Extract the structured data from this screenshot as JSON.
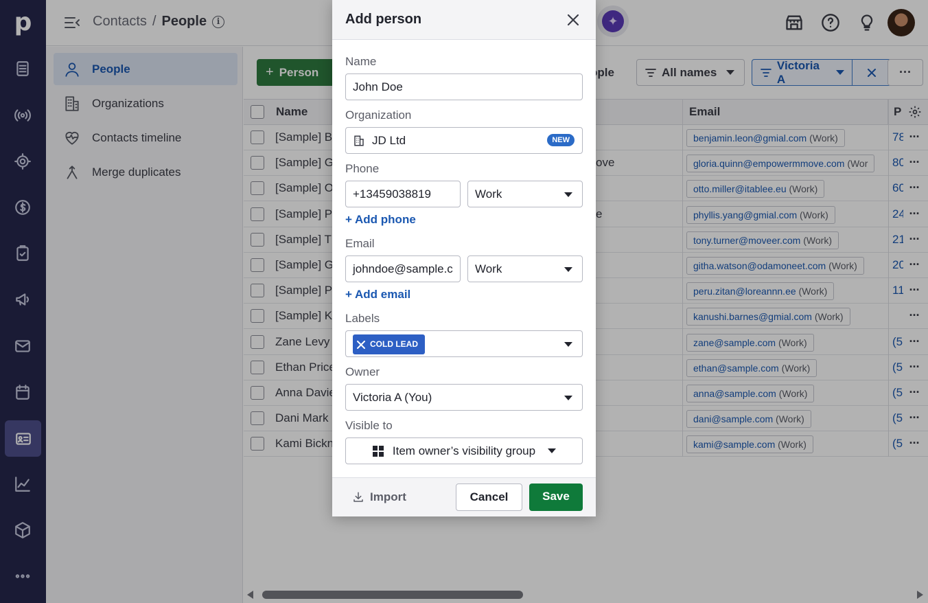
{
  "rail": {
    "logo": "p",
    "items": [
      "deals-icon",
      "leads-icon",
      "projects-icon",
      "revenue-icon",
      "activities-icon",
      "campaigns-icon",
      "mail-icon",
      "calendar-icon",
      "contacts-icon",
      "insights-icon",
      "products-icon",
      "more-icon"
    ],
    "active": "contacts-icon"
  },
  "header": {
    "breadcrumb_parent": "Contacts",
    "breadcrumb_sep": "/",
    "breadcrumb_current": "People",
    "ai_glyph": "✦"
  },
  "sidenav": {
    "items": [
      {
        "label": "People",
        "icon": "person-icon",
        "active": true
      },
      {
        "label": "Organizations",
        "icon": "building-icon",
        "active": false
      },
      {
        "label": "Contacts timeline",
        "icon": "heart-pulse-icon",
        "active": false
      },
      {
        "label": "Merge duplicates",
        "icon": "merge-icon",
        "active": false
      }
    ]
  },
  "toolbar": {
    "add_person": "Person",
    "people_partial": "ople",
    "all_names": "All names",
    "owner_filter": "Victoria A",
    "more": "···"
  },
  "table": {
    "columns": {
      "name": "Name",
      "email": "Email",
      "phone": "P"
    },
    "rows": [
      {
        "name": "[Sample] B",
        "org": "",
        "email": "benjamin.leon@gmial.com",
        "type": "(Work)",
        "phone": "78"
      },
      {
        "name": "[Sample] G",
        "org": "ove",
        "email": "gloria.quinn@empowermmove.com",
        "type": "(Wor",
        "phone": "80"
      },
      {
        "name": "[Sample] O",
        "org": "",
        "email": "otto.miller@itablee.eu",
        "type": "(Work)",
        "phone": "60"
      },
      {
        "name": "[Sample] P",
        "org": "e",
        "email": "phyllis.yang@gmial.com",
        "type": "(Work)",
        "phone": "24"
      },
      {
        "name": "[Sample] T",
        "org": "",
        "email": "tony.turner@moveer.com",
        "type": "(Work)",
        "phone": "21"
      },
      {
        "name": "[Sample] G",
        "org": "",
        "email": "githa.watson@odamoneet.com",
        "type": "(Work)",
        "phone": "20"
      },
      {
        "name": "[Sample] P",
        "org": "",
        "email": "peru.zitan@loreannn.ee",
        "type": "(Work)",
        "phone": "11"
      },
      {
        "name": "[Sample] K",
        "org": "",
        "email": "kanushi.barnes@gmial.com",
        "type": "(Work)",
        "phone": ""
      },
      {
        "name": "Zane Levy",
        "org": "",
        "email": "zane@sample.com",
        "type": "(Work)",
        "phone": "(5"
      },
      {
        "name": "Ethan Price",
        "org": "",
        "email": "ethan@sample.com",
        "type": "(Work)",
        "phone": "(5"
      },
      {
        "name": "Anna Davie",
        "org": "",
        "email": "anna@sample.com",
        "type": "(Work)",
        "phone": "(5"
      },
      {
        "name": "Dani Mark",
        "org": "",
        "email": "dani@sample.com",
        "type": "(Work)",
        "phone": "(5"
      },
      {
        "name": "Kami Bickn",
        "org": "",
        "email": "kami@sample.com",
        "type": "(Work)",
        "phone": "(5"
      }
    ],
    "row_more": "···"
  },
  "modal": {
    "title": "Add person",
    "name_label": "Name",
    "name_value": "John Doe",
    "org_label": "Organization",
    "org_value": "JD Ltd",
    "org_badge": "NEW",
    "phone_label": "Phone",
    "phone_value": "+13459038819",
    "phone_type": "Work",
    "add_phone": "+ Add phone",
    "email_label": "Email",
    "email_value": "johndoe@sample.c",
    "email_type": "Work",
    "add_email": "+ Add email",
    "labels_label": "Labels",
    "label_chip": "COLD LEAD",
    "owner_label": "Owner",
    "owner_value": "Victoria A (You)",
    "visible_label": "Visible to",
    "visible_value": "Item owner’s visibility group",
    "import": "Import",
    "cancel": "Cancel",
    "save": "Save"
  },
  "colors": {
    "rail_bg": "#26284c",
    "primary_green": "#0f7a3a",
    "link_blue": "#1b58b1",
    "label_chip": "#2d5fc4"
  }
}
